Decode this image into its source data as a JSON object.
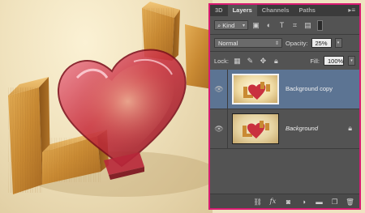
{
  "panel": {
    "tabs": [
      {
        "label": "3D",
        "active": false
      },
      {
        "label": "Layers",
        "active": true
      },
      {
        "label": "Channels",
        "active": false
      },
      {
        "label": "Paths",
        "active": false
      }
    ],
    "menu_icon": "panel-menu-icon",
    "filter": {
      "kind_value": "Kind",
      "kind_icon": "search-icon",
      "filter_icons": [
        "pixel-filter-icon",
        "adjustment-filter-icon",
        "type-filter-icon",
        "shape-filter-icon",
        "smart-object-filter-icon"
      ]
    },
    "blend_mode": "Normal",
    "opacity_label": "Opacity:",
    "opacity_value": "25%",
    "lock_label": "Lock:",
    "lock_icons": [
      "lock-transparent-icon",
      "lock-image-icon",
      "lock-position-icon",
      "lock-all-icon"
    ],
    "fill_label": "Fill:",
    "fill_value": "100%",
    "layers": [
      {
        "name": "Background copy",
        "selected": true,
        "italic": false,
        "locked": false,
        "visible": true
      },
      {
        "name": "Background",
        "selected": false,
        "italic": true,
        "locked": true,
        "visible": true
      }
    ],
    "bottom_icons": [
      "link-layers-icon",
      "fx-icon",
      "layer-mask-icon",
      "adjustment-layer-icon",
      "group-folder-icon",
      "new-layer-icon",
      "trash-icon"
    ]
  },
  "colors": {
    "highlight_border": "#d81b72",
    "panel_bg": "#535353",
    "selected_row": "#5c7493"
  }
}
